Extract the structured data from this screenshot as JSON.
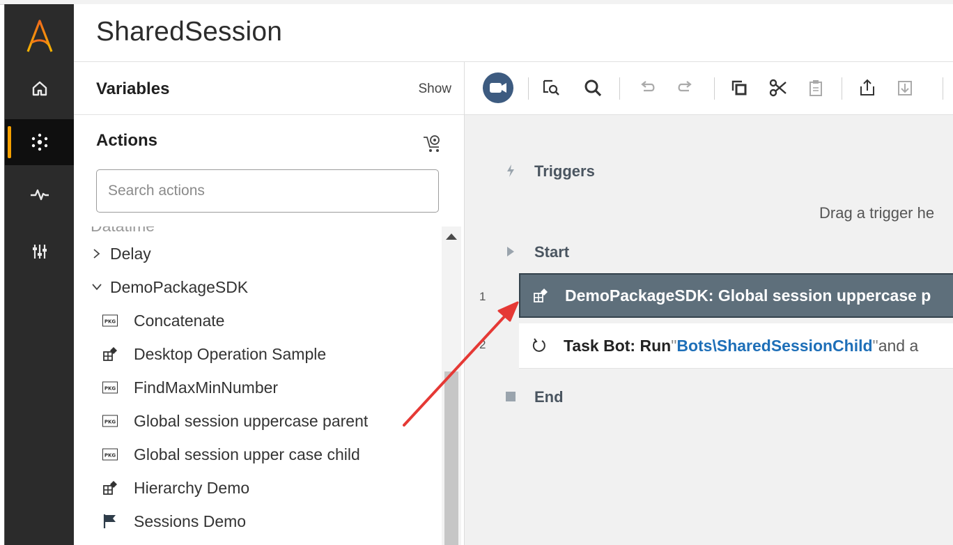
{
  "app": {
    "title": "SharedSession",
    "brand_color": "#f5a000",
    "nav": [
      {
        "name": "home-icon",
        "active": false
      },
      {
        "name": "bots-icon",
        "active": true
      },
      {
        "name": "activity-icon",
        "active": false
      },
      {
        "name": "settings-sliders-icon",
        "active": false
      }
    ]
  },
  "left_panel": {
    "variables_label": "Variables",
    "show_label": "Show",
    "actions_label": "Actions",
    "search_placeholder": "Search actions",
    "clipped_item": "Datatime",
    "tree": [
      {
        "label": "Delay",
        "kind": "folder",
        "expanded": false
      },
      {
        "label": "DemoPackageSDK",
        "kind": "folder",
        "expanded": true
      },
      {
        "label": "Concatenate",
        "kind": "item",
        "icon": "pkg-icon"
      },
      {
        "label": "Desktop Operation Sample",
        "kind": "item",
        "icon": "package-sdk-icon"
      },
      {
        "label": "FindMaxMinNumber",
        "kind": "item",
        "icon": "pkg-icon"
      },
      {
        "label": "Global session uppercase parent",
        "kind": "item",
        "icon": "pkg-icon"
      },
      {
        "label": "Global session upper case child",
        "kind": "item",
        "icon": "pkg-icon"
      },
      {
        "label": "Hierarchy Demo",
        "kind": "item",
        "icon": "package-sdk-icon"
      },
      {
        "label": "Sessions Demo",
        "kind": "item",
        "icon": "flag-icon"
      }
    ]
  },
  "toolbar": {
    "buttons": [
      "record-icon",
      "find-icon",
      "search-icon",
      "undo-icon",
      "redo-icon",
      "copy-icon",
      "cut-icon",
      "paste-icon",
      "export-icon",
      "import-icon"
    ]
  },
  "flow": {
    "triggers_label": "Triggers",
    "drag_text": "Drag a trigger he",
    "start_label": "Start",
    "end_label": "End",
    "steps": [
      {
        "num": "1",
        "text": "DemoPackageSDK: Global session uppercase p"
      },
      {
        "num": "2",
        "prefix": "Task Bot: Run ",
        "quote_open": "\"",
        "path": "Bots\\SharedSessionChild",
        "quote_close": "\"",
        "suffix": " and a"
      }
    ]
  }
}
